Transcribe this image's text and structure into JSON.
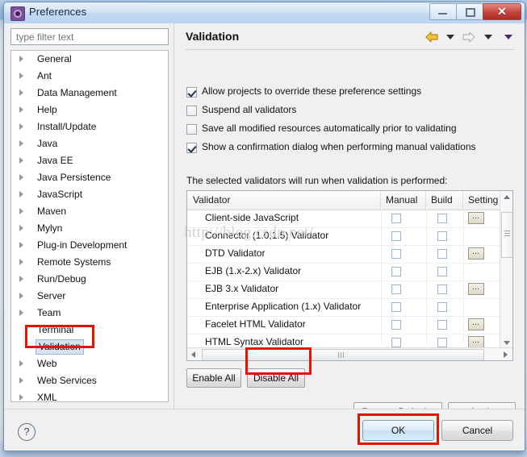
{
  "window": {
    "title": "Preferences",
    "app_icon": "gear-icon",
    "minimize_label": "",
    "maximize_label": "",
    "close_label": "✕"
  },
  "sidebar": {
    "filter": {
      "placeholder": "type filter text",
      "value": ""
    },
    "items": [
      {
        "label": "General",
        "expandable": true,
        "selected": false
      },
      {
        "label": "Ant",
        "expandable": true,
        "selected": false
      },
      {
        "label": "Data Management",
        "expandable": true,
        "selected": false
      },
      {
        "label": "Help",
        "expandable": true,
        "selected": false
      },
      {
        "label": "Install/Update",
        "expandable": true,
        "selected": false
      },
      {
        "label": "Java",
        "expandable": true,
        "selected": false
      },
      {
        "label": "Java EE",
        "expandable": true,
        "selected": false
      },
      {
        "label": "Java Persistence",
        "expandable": true,
        "selected": false
      },
      {
        "label": "JavaScript",
        "expandable": true,
        "selected": false
      },
      {
        "label": "Maven",
        "expandable": true,
        "selected": false
      },
      {
        "label": "Mylyn",
        "expandable": true,
        "selected": false
      },
      {
        "label": "Plug-in Development",
        "expandable": true,
        "selected": false
      },
      {
        "label": "Remote Systems",
        "expandable": true,
        "selected": false
      },
      {
        "label": "Run/Debug",
        "expandable": true,
        "selected": false
      },
      {
        "label": "Server",
        "expandable": true,
        "selected": false
      },
      {
        "label": "Team",
        "expandable": true,
        "selected": false
      },
      {
        "label": "Terminal",
        "expandable": false,
        "selected": false
      },
      {
        "label": "Validation",
        "expandable": false,
        "selected": true
      },
      {
        "label": "Web",
        "expandable": true,
        "selected": false
      },
      {
        "label": "Web Services",
        "expandable": true,
        "selected": false
      },
      {
        "label": "XML",
        "expandable": true,
        "selected": false
      }
    ]
  },
  "page": {
    "title": "Validation",
    "nav": {
      "back_icon": "back-arrow-icon",
      "back_menu_icon": "chevron-down-icon",
      "forward_icon": "forward-arrow-icon",
      "forward_menu_icon": "chevron-down-icon",
      "view_menu_icon": "chevron-down-icon"
    },
    "checkboxes": [
      {
        "label": "Allow projects to override these preference settings",
        "checked": true
      },
      {
        "label": "Suspend all validators",
        "checked": false
      },
      {
        "label": "Save all modified resources automatically prior to validating",
        "checked": false
      },
      {
        "label": "Show a confirmation dialog when performing manual validations",
        "checked": true
      }
    ],
    "hint": "The selected validators will run when validation is performed:",
    "table": {
      "columns": [
        "Validator",
        "Manual",
        "Build",
        "Setting"
      ],
      "rows": [
        {
          "name": "Client-side JavaScript",
          "manual": false,
          "build": false,
          "settings": true
        },
        {
          "name": "Connector (1.0,1.5) Validator",
          "manual": false,
          "build": false,
          "settings": false
        },
        {
          "name": "DTD Validator",
          "manual": false,
          "build": false,
          "settings": true
        },
        {
          "name": "EJB (1.x-2.x) Validator",
          "manual": false,
          "build": false,
          "settings": false
        },
        {
          "name": "EJB 3.x Validator",
          "manual": false,
          "build": false,
          "settings": true
        },
        {
          "name": "Enterprise Application (1.x) Validator",
          "manual": false,
          "build": false,
          "settings": false
        },
        {
          "name": "Facelet HTML Validator",
          "manual": false,
          "build": false,
          "settings": true
        },
        {
          "name": "HTML Syntax Validator",
          "manual": false,
          "build": false,
          "settings": true
        }
      ],
      "settings_button_label": "…"
    },
    "buttons": {
      "enable_all": "Enable All",
      "disable_all": "Disable All",
      "restore_defaults": "Restore Defaults",
      "apply": "Apply"
    }
  },
  "footer": {
    "help_icon": "question-mark-icon",
    "ok": "OK",
    "cancel": "Cancel"
  },
  "annotations": {
    "color": "#e51400",
    "highlighted": [
      "Validation",
      "Disable All",
      "OK"
    ]
  },
  "watermark": "http://blog.csdn.net/"
}
